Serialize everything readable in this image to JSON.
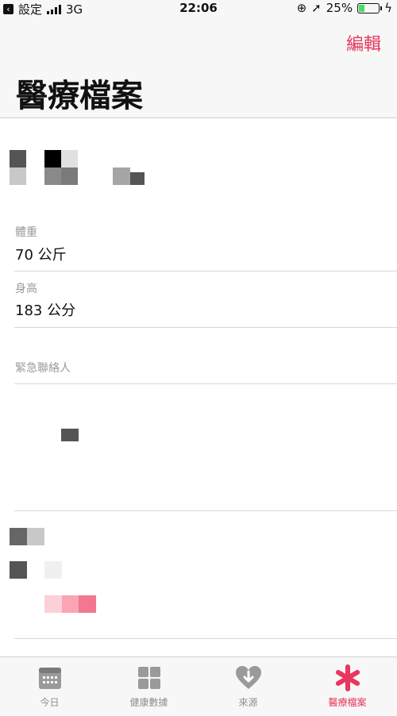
{
  "status_bar": {
    "back_label": "設定",
    "network": "3G",
    "time": "22:06",
    "battery": "25%"
  },
  "nav": {
    "edit_label": "編輯",
    "title": "醫療檔案"
  },
  "profile": {
    "weight_label": "體重",
    "weight_value": "70 公斤",
    "height_label": "身高",
    "height_value": "183 公分",
    "emergency_contact_label": "緊急聯絡人"
  },
  "tabs": [
    {
      "label": "今日",
      "icon": "calendar-icon"
    },
    {
      "label": "健康數據",
      "icon": "grid-icon"
    },
    {
      "label": "來源",
      "icon": "heart-download-icon"
    },
    {
      "label": "醫療檔案",
      "icon": "asterisk-icon"
    }
  ],
  "colors": {
    "accent": "#e8365d",
    "inactive": "#8e8e8e"
  }
}
